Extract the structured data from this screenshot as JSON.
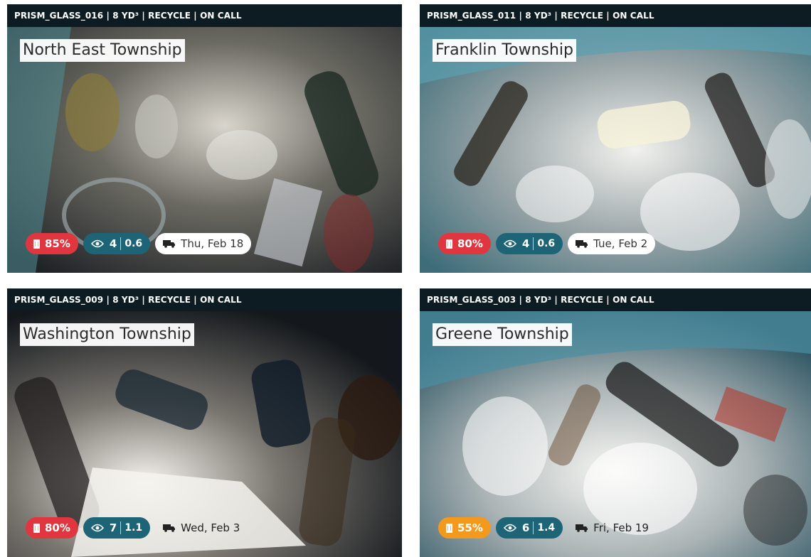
{
  "colors": {
    "header_bg": "#0d1b22",
    "fill_high": "#e0363f",
    "fill_medium": "#f39a1e",
    "views_badge": "#1d6576",
    "pickup_badge": "#ffffff"
  },
  "icons": {
    "fill": "trash-bin-icon",
    "views": "eye-icon",
    "pickup": "truck-icon"
  },
  "cards": [
    {
      "header": "PRISM_GLASS_016 | 8 YD³ | RECYCLE | ON CALL",
      "location": "North East Township",
      "fill_percent": "85%",
      "fill_color": "#e0363f",
      "views_count": "4",
      "views_rate": "0.6",
      "pickup_date": "Thu, Feb 18",
      "pickup_has_bg": true
    },
    {
      "header": "PRISM_GLASS_011 | 8 YD³ | RECYCLE | ON CALL",
      "location": "Franklin Township",
      "fill_percent": "80%",
      "fill_color": "#e0363f",
      "views_count": "4",
      "views_rate": "0.6",
      "pickup_date": "Tue, Feb 2",
      "pickup_has_bg": true
    },
    {
      "header": "PRISM_GLASS_009 | 8 YD³ | RECYCLE | ON CALL",
      "location": "Washington Township",
      "fill_percent": "80%",
      "fill_color": "#e0363f",
      "views_count": "7",
      "views_rate": "1.1",
      "pickup_date": "Wed, Feb 3",
      "pickup_has_bg": false
    },
    {
      "header": "PRISM_GLASS_003 | 8 YD³ | RECYCLE | ON CALL",
      "location": "Greene Township",
      "fill_percent": "55%",
      "fill_color": "#f39a1e",
      "views_count": "6",
      "views_rate": "1.4",
      "pickup_date": "Fri, Feb 19",
      "pickup_has_bg": false
    }
  ]
}
